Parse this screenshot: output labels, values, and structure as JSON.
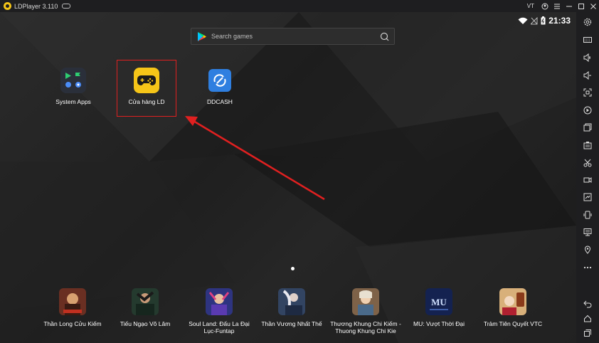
{
  "window": {
    "title": "LDPlayer 3.110",
    "vt_badge": "VT",
    "controls": [
      "account-icon",
      "menu-icon",
      "minimize-icon",
      "maximize-icon",
      "close-icon"
    ]
  },
  "status_bar": {
    "time": "21:33"
  },
  "search": {
    "placeholder": "Search games"
  },
  "desktop_apps": [
    {
      "label": "System Apps",
      "icon": "system-apps-icon"
    },
    {
      "label": "Cửa hàng LD",
      "icon": "ld-store-icon",
      "highlighted": true,
      "accent": "#f5c518"
    },
    {
      "label": "DDCASH",
      "icon": "ddcash-icon",
      "accent": "#2f7fe0"
    }
  ],
  "dock_apps": [
    {
      "label": "Thần Long Cửu Kiếm",
      "color": "#7a3a2a"
    },
    {
      "label": "Tiếu Ngạo Võ Lâm",
      "color": "#2e4a3a"
    },
    {
      "label": "Soul Land: Đấu La Đại Lục-Funtap",
      "color": "#3a3d8a"
    },
    {
      "label": "Thần Vương Nhất Thế",
      "color": "#3b4a6a"
    },
    {
      "label": "Thương Khung Chi Kiếm - Thuong Khung Chi Kie",
      "color": "#8a6a4a"
    },
    {
      "label": "MU: Vượt Thời Đại",
      "color": "#1a2a5a"
    },
    {
      "label": "Trảm Tiên Quyết VTC",
      "color": "#c8a060"
    }
  ],
  "sidebar": [
    "settings-icon",
    "keyboard-icon",
    "volume-up-icon",
    "volume-down-icon",
    "fullscreen-icon",
    "install-apk-icon",
    "multi-instance-icon",
    "screenshot-icon",
    "cut-icon",
    "record-icon",
    "sync-icon",
    "rotate-icon",
    "monitor-icon",
    "location-icon",
    "more-icon",
    "back-icon",
    "home-icon",
    "recents-icon"
  ],
  "colors": {
    "highlight": "#e02020",
    "background": "#1a1a1a"
  }
}
